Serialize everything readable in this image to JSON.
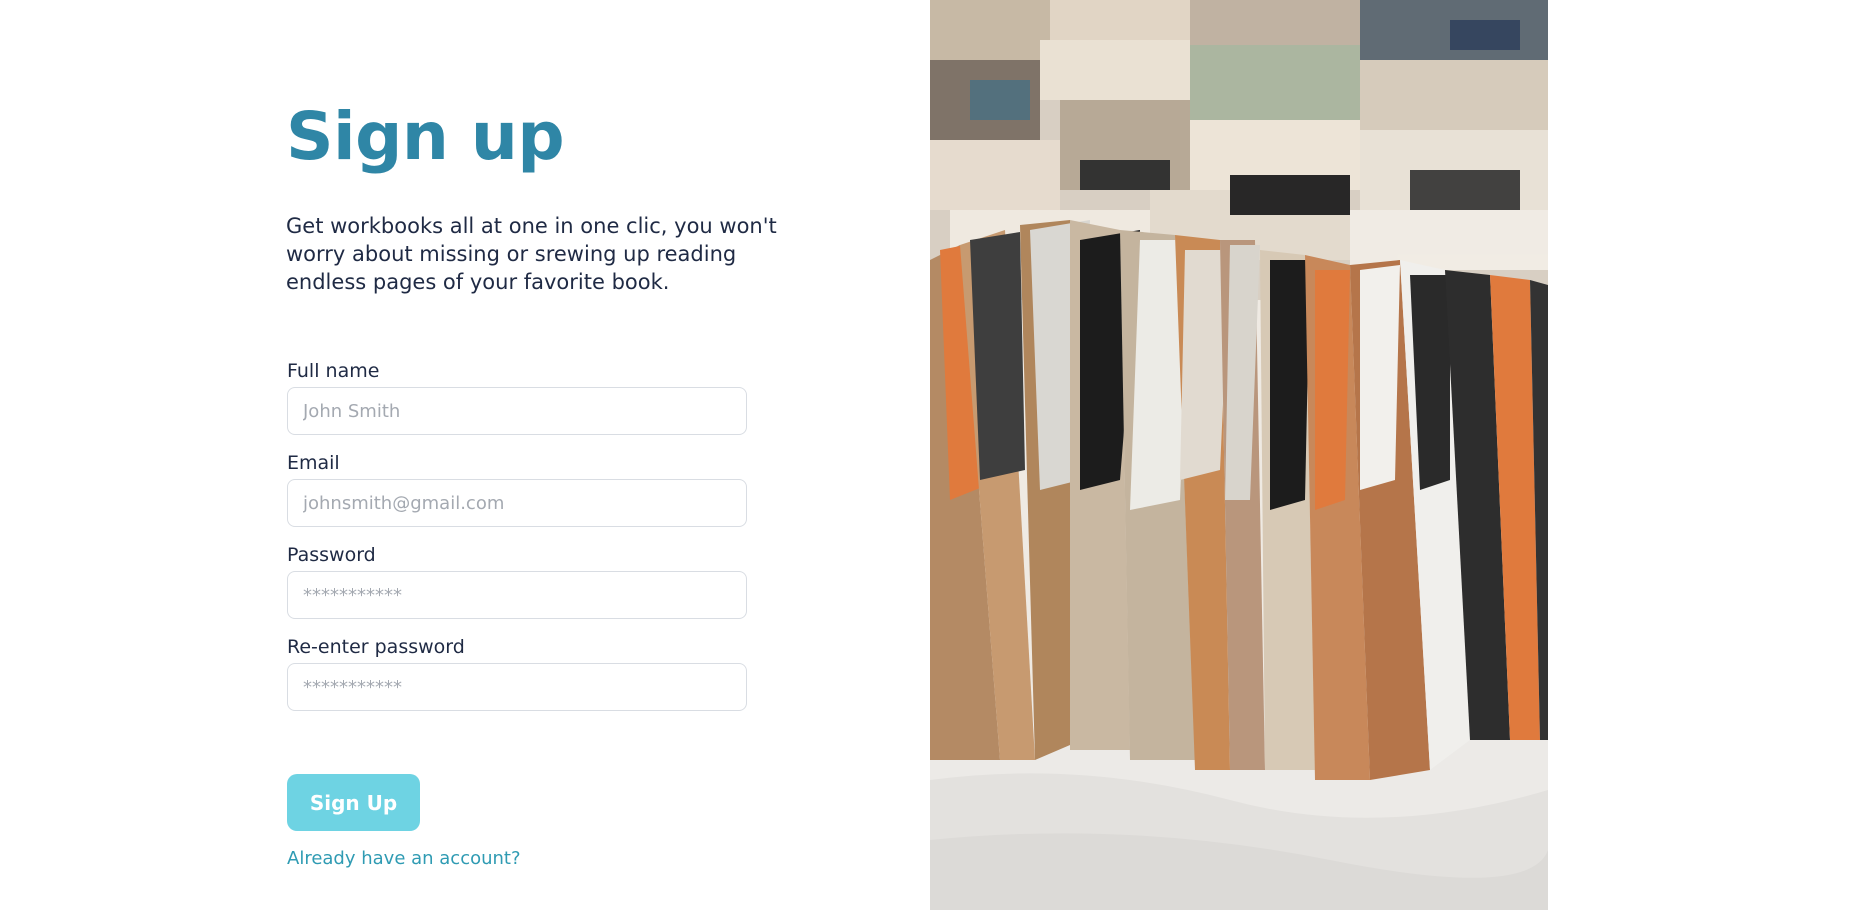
{
  "signup": {
    "title": "Sign up",
    "subtitle": "Get workbooks all at one in one clic, you won't worry about missing or srewing up reading endless pages of your favorite book.",
    "fields": [
      {
        "label": "Full name",
        "placeholder": "John Smith",
        "value": ""
      },
      {
        "label": "Email",
        "placeholder": "johnsmith@gmail.com",
        "value": ""
      },
      {
        "label": "Password",
        "placeholder": "***********",
        "value": ""
      },
      {
        "label": "Re-enter password",
        "placeholder": "***********",
        "value": ""
      }
    ],
    "submit_label": "Sign Up",
    "login_link": "Already have an account?"
  },
  "hero_image": {
    "alt": "books-photo"
  },
  "colors": {
    "title": "#2f86a6",
    "text": "#1f2a44",
    "button": "#6ed3e3",
    "link": "#2f9bb3",
    "input_border": "#d9dde3"
  }
}
